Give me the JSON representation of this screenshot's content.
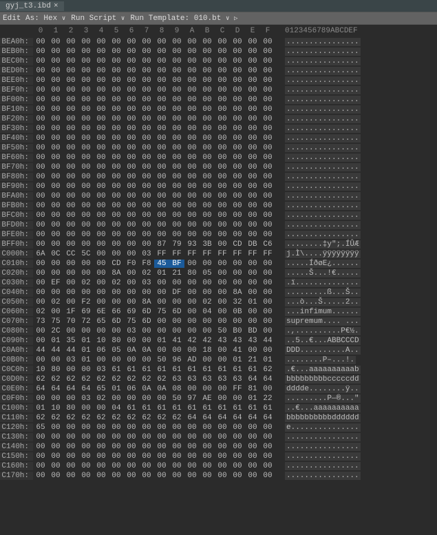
{
  "tab": {
    "filename": "gyj_t3.ibd",
    "close": "×"
  },
  "toolbar": {
    "edit_as": "Edit As: ",
    "edit_mode": "Hex",
    "run_script": "Run Script",
    "run_template": "Run Template: ",
    "template_name": "010.bt"
  },
  "header": {
    "hex_cols": [
      "0",
      "1",
      "2",
      "3",
      "4",
      "5",
      "6",
      "7",
      "8",
      "9",
      "A",
      "B",
      "C",
      "D",
      "E",
      "F"
    ],
    "ascii": "0123456789ABCDEF"
  },
  "rows": [
    {
      "addr": "BEA0h:",
      "hex": [
        "00",
        "00",
        "00",
        "00",
        "00",
        "00",
        "00",
        "00",
        "00",
        "00",
        "00",
        "00",
        "00",
        "00",
        "00",
        "00"
      ],
      "asc": "................"
    },
    {
      "addr": "BEB0h:",
      "hex": [
        "00",
        "00",
        "00",
        "00",
        "00",
        "00",
        "00",
        "00",
        "00",
        "00",
        "00",
        "00",
        "00",
        "00",
        "00",
        "00"
      ],
      "asc": "................"
    },
    {
      "addr": "BEC0h:",
      "hex": [
        "00",
        "00",
        "00",
        "00",
        "00",
        "00",
        "00",
        "00",
        "00",
        "00",
        "00",
        "00",
        "00",
        "00",
        "00",
        "00"
      ],
      "asc": "................"
    },
    {
      "addr": "BED0h:",
      "hex": [
        "00",
        "00",
        "00",
        "00",
        "00",
        "00",
        "00",
        "00",
        "00",
        "00",
        "00",
        "00",
        "00",
        "00",
        "00",
        "00"
      ],
      "asc": "................"
    },
    {
      "addr": "BEE0h:",
      "hex": [
        "00",
        "00",
        "00",
        "00",
        "00",
        "00",
        "00",
        "00",
        "00",
        "00",
        "00",
        "00",
        "00",
        "00",
        "00",
        "00"
      ],
      "asc": "................"
    },
    {
      "addr": "BEF0h:",
      "hex": [
        "00",
        "00",
        "00",
        "00",
        "00",
        "00",
        "00",
        "00",
        "00",
        "00",
        "00",
        "00",
        "00",
        "00",
        "00",
        "00"
      ],
      "asc": "................"
    },
    {
      "addr": "BF00h:",
      "hex": [
        "00",
        "00",
        "00",
        "00",
        "00",
        "00",
        "00",
        "00",
        "00",
        "00",
        "00",
        "00",
        "00",
        "00",
        "00",
        "00"
      ],
      "asc": "................"
    },
    {
      "addr": "BF10h:",
      "hex": [
        "00",
        "00",
        "00",
        "00",
        "00",
        "00",
        "00",
        "00",
        "00",
        "00",
        "00",
        "00",
        "00",
        "00",
        "00",
        "00"
      ],
      "asc": "................"
    },
    {
      "addr": "BF20h:",
      "hex": [
        "00",
        "00",
        "00",
        "00",
        "00",
        "00",
        "00",
        "00",
        "00",
        "00",
        "00",
        "00",
        "00",
        "00",
        "00",
        "00"
      ],
      "asc": "................"
    },
    {
      "addr": "BF30h:",
      "hex": [
        "00",
        "00",
        "00",
        "00",
        "00",
        "00",
        "00",
        "00",
        "00",
        "00",
        "00",
        "00",
        "00",
        "00",
        "00",
        "00"
      ],
      "asc": "................"
    },
    {
      "addr": "BF40h:",
      "hex": [
        "00",
        "00",
        "00",
        "00",
        "00",
        "00",
        "00",
        "00",
        "00",
        "00",
        "00",
        "00",
        "00",
        "00",
        "00",
        "00"
      ],
      "asc": "................"
    },
    {
      "addr": "BF50h:",
      "hex": [
        "00",
        "00",
        "00",
        "00",
        "00",
        "00",
        "00",
        "00",
        "00",
        "00",
        "00",
        "00",
        "00",
        "00",
        "00",
        "00"
      ],
      "asc": "................"
    },
    {
      "addr": "BF60h:",
      "hex": [
        "00",
        "00",
        "00",
        "00",
        "00",
        "00",
        "00",
        "00",
        "00",
        "00",
        "00",
        "00",
        "00",
        "00",
        "00",
        "00"
      ],
      "asc": "................"
    },
    {
      "addr": "BF70h:",
      "hex": [
        "00",
        "00",
        "00",
        "00",
        "00",
        "00",
        "00",
        "00",
        "00",
        "00",
        "00",
        "00",
        "00",
        "00",
        "00",
        "00"
      ],
      "asc": "................"
    },
    {
      "addr": "BF80h:",
      "hex": [
        "00",
        "00",
        "00",
        "00",
        "00",
        "00",
        "00",
        "00",
        "00",
        "00",
        "00",
        "00",
        "00",
        "00",
        "00",
        "00"
      ],
      "asc": "................"
    },
    {
      "addr": "BF90h:",
      "hex": [
        "00",
        "00",
        "00",
        "00",
        "00",
        "00",
        "00",
        "00",
        "00",
        "00",
        "00",
        "00",
        "00",
        "00",
        "00",
        "00"
      ],
      "asc": "................"
    },
    {
      "addr": "BFA0h:",
      "hex": [
        "00",
        "00",
        "00",
        "00",
        "00",
        "00",
        "00",
        "00",
        "00",
        "00",
        "00",
        "00",
        "00",
        "00",
        "00",
        "00"
      ],
      "asc": "................"
    },
    {
      "addr": "BFB0h:",
      "hex": [
        "00",
        "00",
        "00",
        "00",
        "00",
        "00",
        "00",
        "00",
        "00",
        "00",
        "00",
        "00",
        "00",
        "00",
        "00",
        "00"
      ],
      "asc": "................"
    },
    {
      "addr": "BFC0h:",
      "hex": [
        "00",
        "00",
        "00",
        "00",
        "00",
        "00",
        "00",
        "00",
        "00",
        "00",
        "00",
        "00",
        "00",
        "00",
        "00",
        "00"
      ],
      "asc": "................"
    },
    {
      "addr": "BFD0h:",
      "hex": [
        "00",
        "00",
        "00",
        "00",
        "00",
        "00",
        "00",
        "00",
        "00",
        "00",
        "00",
        "00",
        "00",
        "00",
        "00",
        "00"
      ],
      "asc": "................"
    },
    {
      "addr": "BFE0h:",
      "hex": [
        "00",
        "00",
        "00",
        "00",
        "00",
        "00",
        "00",
        "00",
        "00",
        "00",
        "00",
        "00",
        "00",
        "00",
        "00",
        "00"
      ],
      "asc": "................"
    },
    {
      "addr": "BFF0h:",
      "hex": [
        "00",
        "00",
        "00",
        "00",
        "00",
        "00",
        "00",
        "00",
        "87",
        "79",
        "93",
        "3B",
        "00",
        "CD",
        "DB",
        "C6"
      ],
      "asc": "........‡y\";.ÍÛÆ"
    },
    {
      "addr": "C000h:",
      "hex": [
        "6A",
        "0C",
        "CC",
        "5C",
        "00",
        "00",
        "00",
        "03",
        "FF",
        "FF",
        "FF",
        "FF",
        "FF",
        "FF",
        "FF",
        "FF"
      ],
      "asc": "j.Ì\\....ÿÿÿÿÿÿÿÿ"
    },
    {
      "addr": "C010h:",
      "hex": [
        "00",
        "00",
        "00",
        "00",
        "00",
        "CD",
        "F0",
        "F8",
        "45",
        "BF",
        "00",
        "00",
        "00",
        "00",
        "00",
        "00"
      ],
      "asc": ".....ÍðøE¿......",
      "hl": [
        8,
        9
      ]
    },
    {
      "addr": "C020h:",
      "hex": [
        "00",
        "00",
        "00",
        "00",
        "00",
        "8A",
        "00",
        "02",
        "01",
        "21",
        "80",
        "05",
        "00",
        "00",
        "00",
        "00"
      ],
      "asc": ".....Š...!€....."
    },
    {
      "addr": "C030h:",
      "hex": [
        "00",
        "EF",
        "00",
        "02",
        "00",
        "02",
        "00",
        "03",
        "00",
        "00",
        "00",
        "00",
        "00",
        "00",
        "00",
        "00"
      ],
      "asc": ".ï.............."
    },
    {
      "addr": "C040h:",
      "hex": [
        "00",
        "00",
        "00",
        "00",
        "00",
        "00",
        "00",
        "00",
        "00",
        "DF",
        "00",
        "00",
        "00",
        "8A",
        "00",
        "00"
      ],
      "asc": ".........ß...Š.."
    },
    {
      "addr": "C050h:",
      "hex": [
        "00",
        "02",
        "00",
        "F2",
        "00",
        "00",
        "00",
        "8A",
        "00",
        "00",
        "00",
        "02",
        "00",
        "32",
        "01",
        "00"
      ],
      "asc": "...ò...Š.....2.."
    },
    {
      "addr": "C060h:",
      "hex": [
        "02",
        "00",
        "1F",
        "69",
        "6E",
        "66",
        "69",
        "6D",
        "75",
        "6D",
        "00",
        "04",
        "00",
        "0B",
        "00",
        "00"
      ],
      "asc": "...infimum......"
    },
    {
      "addr": "C070h:",
      "hex": [
        "73",
        "75",
        "70",
        "72",
        "65",
        "6D",
        "75",
        "6D",
        "00",
        "00",
        "00",
        "00",
        "00",
        "00",
        "00",
        "00"
      ],
      "asc": "supremum.... ..."
    },
    {
      "addr": "C080h:",
      "hex": [
        "00",
        "2C",
        "00",
        "00",
        "00",
        "00",
        "03",
        "00",
        "00",
        "00",
        "00",
        "00",
        "50",
        "B0",
        "BD",
        "00"
      ],
      "asc": ".,..........P€½."
    },
    {
      "addr": "C090h:",
      "hex": [
        "00",
        "01",
        "35",
        "01",
        "10",
        "80",
        "00",
        "00",
        "01",
        "41",
        "42",
        "42",
        "43",
        "43",
        "43",
        "44"
      ],
      "asc": "..5..€...ABBCCCD"
    },
    {
      "addr": "C0A0h:",
      "hex": [
        "44",
        "44",
        "44",
        "01",
        "06",
        "05",
        "0A",
        "0A",
        "00",
        "00",
        "00",
        "18",
        "00",
        "41",
        "00",
        "00"
      ],
      "asc": "DDD..........A.."
    },
    {
      "addr": "C0B0h:",
      "hex": [
        "00",
        "00",
        "03",
        "01",
        "00",
        "00",
        "00",
        "00",
        "50",
        "96",
        "AD",
        "00",
        "00",
        "01",
        "21",
        "01"
      ],
      "asc": "........P–­...!."
    },
    {
      "addr": "C0C0h:",
      "hex": [
        "10",
        "80",
        "00",
        "00",
        "03",
        "61",
        "61",
        "61",
        "61",
        "61",
        "61",
        "61",
        "61",
        "61",
        "61",
        "62"
      ],
      "asc": ".€...aaaaaaaaaab"
    },
    {
      "addr": "C0D0h:",
      "hex": [
        "62",
        "62",
        "62",
        "62",
        "62",
        "62",
        "62",
        "62",
        "62",
        "63",
        "63",
        "63",
        "63",
        "63",
        "64",
        "64"
      ],
      "asc": "bbbbbbbbbcccccdd"
    },
    {
      "addr": "C0E0h:",
      "hex": [
        "64",
        "64",
        "64",
        "64",
        "65",
        "01",
        "06",
        "0A",
        "0A",
        "08",
        "00",
        "00",
        "00",
        "FF",
        "81",
        "00"
      ],
      "asc": "dddde........ÿ.."
    },
    {
      "addr": "C0F0h:",
      "hex": [
        "00",
        "00",
        "00",
        "03",
        "02",
        "00",
        "00",
        "00",
        "00",
        "50",
        "97",
        "AE",
        "00",
        "00",
        "01",
        "22"
      ],
      "asc": ".........P—®...\""
    },
    {
      "addr": "C100h:",
      "hex": [
        "01",
        "10",
        "80",
        "00",
        "00",
        "04",
        "61",
        "61",
        "61",
        "61",
        "61",
        "61",
        "61",
        "61",
        "61",
        "61"
      ],
      "asc": "..€...aaaaaaaaaa"
    },
    {
      "addr": "C110h:",
      "hex": [
        "62",
        "62",
        "62",
        "62",
        "62",
        "62",
        "62",
        "62",
        "62",
        "62",
        "64",
        "64",
        "64",
        "64",
        "64",
        "64"
      ],
      "asc": "bbbbbbbbbbdddddd"
    },
    {
      "addr": "C120h:",
      "hex": [
        "65",
        "00",
        "00",
        "00",
        "00",
        "00",
        "00",
        "00",
        "00",
        "00",
        "00",
        "00",
        "00",
        "00",
        "00",
        "00"
      ],
      "asc": "e..............."
    },
    {
      "addr": "C130h:",
      "hex": [
        "00",
        "00",
        "00",
        "00",
        "00",
        "00",
        "00",
        "00",
        "00",
        "00",
        "00",
        "00",
        "00",
        "00",
        "00",
        "00"
      ],
      "asc": "................"
    },
    {
      "addr": "C140h:",
      "hex": [
        "00",
        "00",
        "00",
        "00",
        "00",
        "00",
        "00",
        "00",
        "00",
        "00",
        "00",
        "00",
        "00",
        "00",
        "00",
        "00"
      ],
      "asc": "................"
    },
    {
      "addr": "C150h:",
      "hex": [
        "00",
        "00",
        "00",
        "00",
        "00",
        "00",
        "00",
        "00",
        "00",
        "00",
        "00",
        "00",
        "00",
        "00",
        "00",
        "00"
      ],
      "asc": "................"
    },
    {
      "addr": "C160h:",
      "hex": [
        "00",
        "00",
        "00",
        "00",
        "00",
        "00",
        "00",
        "00",
        "00",
        "00",
        "00",
        "00",
        "00",
        "00",
        "00",
        "00"
      ],
      "asc": "................"
    },
    {
      "addr": "C170h:",
      "hex": [
        "00",
        "00",
        "00",
        "00",
        "00",
        "00",
        "00",
        "00",
        "00",
        "00",
        "00",
        "00",
        "00",
        "00",
        "00",
        "00"
      ],
      "asc": "................"
    }
  ]
}
